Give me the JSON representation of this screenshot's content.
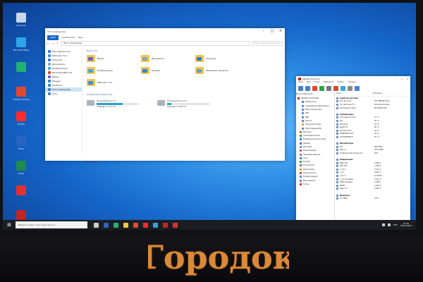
{
  "desktop": {
    "icons": [
      {
        "name": "recycle-bin-icon",
        "label": "Корзина",
        "color": "#c9d6e6"
      },
      {
        "name": "edge-icon",
        "label": "Microsoft Edge",
        "color": "#2ea7e8"
      },
      {
        "name": "edge-icon-2",
        "label": "",
        "color": "#1fb372"
      },
      {
        "name": "chrome-icon",
        "label": "Google Chrome",
        "color": "#e5462f"
      },
      {
        "name": "yandex-icon",
        "label": "Yandex",
        "color": "#ff2b2b"
      },
      {
        "name": "word-icon",
        "label": "Word",
        "color": "#2b63c0"
      },
      {
        "name": "excel-icon",
        "label": "Excel",
        "color": "#1f8b4c"
      },
      {
        "name": "red-app-icon",
        "label": "",
        "color": "#e53030"
      },
      {
        "name": "aida64-icon",
        "label": "AIDA64",
        "color": "#c42323"
      },
      {
        "name": "green-app-icon",
        "label": "",
        "color": "#7bbd3a"
      }
    ]
  },
  "explorer": {
    "title": "Этот компьютер",
    "ribbon": {
      "file": "Файл",
      "tabs": [
        "Компьютер",
        "Вид"
      ]
    },
    "address": "Этот компьютер",
    "search_placeholder": "Поиск: Этот компьютер",
    "sidebar": [
      {
        "label": "Быстрый доступ",
        "color": "#2c7be5",
        "selected": false
      },
      {
        "label": "Рабочий стол",
        "color": "#3b8fe0",
        "selected": false
      },
      {
        "label": "Загрузки",
        "color": "#2c7be5",
        "selected": false
      },
      {
        "label": "Документы",
        "color": "#8aa3c0",
        "selected": false
      },
      {
        "label": "Изображения",
        "color": "#4aa3e8",
        "selected": false
      },
      {
        "label": "Microsoft Office 20",
        "color": "#d04a2e",
        "selected": false
      },
      {
        "label": "Видео",
        "color": "#6a5fd0",
        "selected": false
      },
      {
        "label": "Музыка",
        "color": "#2b88d8",
        "selected": false
      },
      {
        "label": "OneDrive",
        "color": "#2b88d8",
        "selected": false
      },
      {
        "label": "Этот компьютер",
        "color": "#4d7fc4",
        "selected": true
      },
      {
        "label": "Сеть",
        "color": "#4d7fc4",
        "selected": false
      }
    ],
    "folders_header": "Папки (7)",
    "folders": [
      {
        "label": "Видео",
        "color": "#6a5fd0"
      },
      {
        "label": "Документы",
        "color": "#8aa3c0"
      },
      {
        "label": "Загрузки",
        "color": "#2c7be5"
      },
      {
        "label": "Изображения",
        "color": "#4aa3e8"
      },
      {
        "label": "Музыка",
        "color": "#2b88d8"
      },
      {
        "label": "Объемные объекты",
        "color": "#55a0e0"
      },
      {
        "label": "Рабочий стол",
        "color": "#3b8fe0"
      }
    ],
    "drives_header": "Устройства и диски (2)",
    "drives": [
      {
        "label": "Локальный диск (C:)",
        "free": "свободно из 111 ГБ",
        "used_pct": 0.62
      },
      {
        "label": "Локальный диск (D:)",
        "free": "свободно из 465 ГБ",
        "used_pct": 0.1
      }
    ],
    "status": "Элементов: 9"
  },
  "aida": {
    "title": "AIDA64 Extreme",
    "menu": [
      "Файл",
      "Вид",
      "Отчёт",
      "Избранное",
      "Сервис",
      "Справка"
    ],
    "tool_colors": [
      "#4a80c8",
      "#4a80c8",
      "#e5462f",
      "#2ea04a",
      "#777777",
      "#d04a2e",
      "#2ea7e8",
      "#888888",
      "#4a80c8"
    ],
    "tree_tabs": "Меню  Избранное",
    "tree": [
      {
        "label": "AIDA64 v6.25.5400",
        "color": "#c42323"
      },
      {
        "label": "Компьютер",
        "color": "#4d7fc4"
      },
      {
        "label": "Суммарная информация",
        "color": "#5a8fd0"
      },
      {
        "label": "Имя компьютера",
        "color": "#5a8fd0"
      },
      {
        "label": "DMI",
        "color": "#5a8fd0"
      },
      {
        "label": "IPMI",
        "color": "#5a8fd0"
      },
      {
        "label": "Разгон",
        "color": "#5a8fd0"
      },
      {
        "label": "Электропитание",
        "color": "#e0a020"
      },
      {
        "label": "Портативный ПК",
        "color": "#5a8fd0"
      },
      {
        "label": "Датчики",
        "color": "#e07020"
      },
      {
        "label": "Системная плата",
        "color": "#3aa050"
      },
      {
        "label": "Операционная система",
        "color": "#2b88d8"
      },
      {
        "label": "Сервер",
        "color": "#6a6ab0"
      },
      {
        "label": "Дисплей",
        "color": "#4aa3e8"
      },
      {
        "label": "Мультимедиа",
        "color": "#d04a80"
      },
      {
        "label": "Хранение данных",
        "color": "#888888"
      },
      {
        "label": "Сеть",
        "color": "#4d7fc4"
      },
      {
        "label": "DirectX",
        "color": "#3aa050"
      },
      {
        "label": "Устройства",
        "color": "#7a7a7a"
      },
      {
        "label": "Программы",
        "color": "#e0a020"
      },
      {
        "label": "Безопасность",
        "color": "#d04a2e"
      },
      {
        "label": "Конфигурация",
        "color": "#5a8fd0"
      },
      {
        "label": "База данных",
        "color": "#5a8fd0"
      },
      {
        "label": "Тесты",
        "color": "#e53030"
      }
    ],
    "columns": [
      "Поле",
      "Значение"
    ],
    "rows": [
      {
        "k": "Свойства датчика",
        "v": "",
        "grp": true
      },
      {
        "k": "Тип датчика",
        "v": "ITE IT8628E (ISA...",
        "grp": false
      },
      {
        "k": "Тип датчика ГП",
        "v": "Diode (NV-Diode)",
        "grp": false
      },
      {
        "k": "Системная плата",
        "v": "MSI B450 (MS-...",
        "grp": false
      },
      {
        "k": "",
        "v": "",
        "grp": false
      },
      {
        "k": "Температуры",
        "v": "",
        "grp": true
      },
      {
        "k": "Системная плата",
        "v": "37 °C",
        "grp": false
      },
      {
        "k": "ЦП",
        "v": "39 °C",
        "grp": false
      },
      {
        "k": "ЦП диод",
        "v": "41 °C",
        "grp": false
      },
      {
        "k": "Диод ГП",
        "v": "48 °C",
        "grp": false
      },
      {
        "k": "Южный мост",
        "v": "52 °C",
        "grp": false
      },
      {
        "k": "SAMSUNG SSD",
        "v": "34 °C",
        "grp": false
      },
      {
        "k": "ST1000DM010",
        "v": "35 °C",
        "grp": false
      },
      {
        "k": "",
        "v": "",
        "grp": false
      },
      {
        "k": "Вентиляторы",
        "v": "",
        "grp": true
      },
      {
        "k": "ЦП",
        "v": "880 RPM",
        "grp": false
      },
      {
        "k": "Шасси",
        "v": "1012 RPM",
        "grp": false
      },
      {
        "k": "Графический процессор",
        "v": "29%",
        "grp": false
      },
      {
        "k": "",
        "v": "",
        "grp": false
      },
      {
        "k": "Напряжения",
        "v": "",
        "grp": true
      },
      {
        "k": "Ядро ЦП",
        "v": "0.960 V",
        "grp": false
      },
      {
        "k": "CPU VID",
        "v": "1.038 V",
        "grp": false
      },
      {
        "k": "+3.3 V",
        "v": "3.312 V",
        "grp": false
      },
      {
        "k": "+5 V",
        "v": "5.040 V",
        "grp": false
      },
      {
        "k": "+12 V",
        "v": "12.096 V",
        "grp": false
      },
      {
        "k": "+3.3 V резерв",
        "v": "3.312 V",
        "grp": false
      },
      {
        "k": "VBAT батарея",
        "v": "3.168 V",
        "grp": false
      },
      {
        "k": "DIMM",
        "v": "1.200 V",
        "grp": false
      },
      {
        "k": "Ядро ГП",
        "v": "0.662 V",
        "grp": false
      },
      {
        "k": "",
        "v": "",
        "grp": false
      },
      {
        "k": "Мощность",
        "v": "",
        "grp": true
      },
      {
        "k": "ГП TDP%",
        "v": "15%",
        "grp": false
      }
    ]
  },
  "taskbar": {
    "start": "⊞",
    "search": "Введите здесь текст для поиска",
    "app_colors": [
      "#cccccc",
      "#2b63c0",
      "#1fb372",
      "#f5c542",
      "#e5462f",
      "#ff2b2b",
      "#2ea7e8",
      "#c42323",
      "#e53030"
    ],
    "lang": "РУС",
    "time": "11:45",
    "date": "26.03.2021"
  },
  "watermark": {
    "text": "Городок",
    "fill": "#d88a3a",
    "stroke": "#3a1e08"
  }
}
